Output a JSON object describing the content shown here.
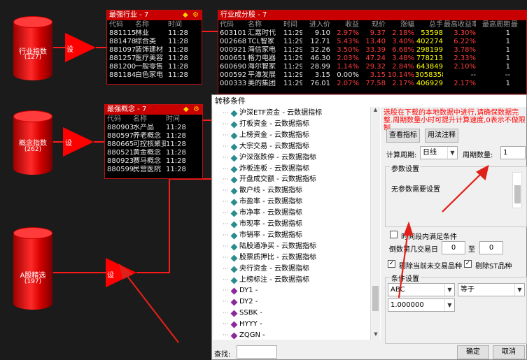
{
  "left_nodes": [
    {
      "label": "行业指数",
      "count": "(127)",
      "btn": "设"
    },
    {
      "label": "概念指数",
      "count": "(262)",
      "btn": "设"
    },
    {
      "label": "A股精选",
      "count": "(197)",
      "btn": "设"
    }
  ],
  "industry_panel": {
    "title": "最强行业 - 7",
    "headers": [
      "代码",
      "名称",
      "时间"
    ],
    "rows": [
      [
        "881115",
        "林业",
        "11:28"
      ],
      [
        "881478",
        "综合类",
        "11:28"
      ],
      [
        "881097",
        "装饰建材",
        "11:28"
      ],
      [
        "881257",
        "医疗美容",
        "11:28"
      ],
      [
        "881200",
        "一般零售",
        "11:28"
      ],
      [
        "881184",
        "白色家电",
        "11:28"
      ]
    ]
  },
  "concept_panel": {
    "title": "最强概念 - 7",
    "headers": [
      "代码",
      "名称",
      "时间"
    ],
    "rows": [
      [
        "880903",
        "水产品",
        "11:28"
      ],
      [
        "880597",
        "养老概念",
        "11:28"
      ],
      [
        "880665",
        "可控核聚变",
        "11:28"
      ],
      [
        "880521",
        "黄金概念",
        "11:28"
      ],
      [
        "880923",
        "赛马概念",
        "11:28"
      ],
      [
        "880599",
        "民营医院",
        "11:28"
      ]
    ]
  },
  "component_panel": {
    "title": "行业成分股 - 7",
    "headers": [
      "代码",
      "名称",
      "时间",
      "进入价",
      "收益",
      "现价",
      "涨幅",
      "总手",
      "最高收益率",
      "最高周期",
      "最"
    ],
    "rows": [
      [
        "603101",
        "汇嘉时代",
        "11:29",
        "9.10",
        "2.97%",
        "9.37",
        "2.18%",
        "53598",
        "3.30%",
        "1",
        ""
      ],
      [
        "002668",
        "TCL智家",
        "11:29",
        "12.71",
        "5.43%",
        "13.40",
        "3.40%",
        "402274",
        "6.22%",
        "1",
        ""
      ],
      [
        "000921",
        "海信家电",
        "11:29",
        "32.26",
        "3.50%",
        "33.39",
        "6.68%",
        "298199",
        "3.78%",
        "1",
        ""
      ],
      [
        "000651",
        "格力电器",
        "11:29",
        "46.30",
        "2.03%",
        "47.24",
        "3.48%",
        "778213",
        "2.33%",
        "1",
        ""
      ],
      [
        "600690",
        "海尔智家",
        "11:29",
        "28.99",
        "1.14%",
        "29.32",
        "2.84%",
        "643849",
        "2.10%",
        "1",
        ""
      ],
      [
        "000592",
        "平潭发展",
        "11:29",
        "3.15",
        "0.00%",
        "3.15",
        "10.14%",
        "3058358",
        "--",
        "--",
        ""
      ],
      [
        "000333",
        "美的集团",
        "11:29",
        "76.01",
        "2.07%",
        "77.58",
        "2.17%",
        "406929",
        "2.17%",
        "1",
        ""
      ]
    ]
  },
  "dialog": {
    "title": "转移条件",
    "list_items": [
      {
        "text": "沪深ETF资金 - 云数据指标",
        "kind": "teal"
      },
      {
        "text": "打板资金 - 云数据指标",
        "kind": "teal"
      },
      {
        "text": "上榜资金 - 云数据指标",
        "kind": "teal"
      },
      {
        "text": "大宗交易 - 云数据指标",
        "kind": "teal"
      },
      {
        "text": "沪深涨跌停 - 云数据指标",
        "kind": "teal"
      },
      {
        "text": "炸板连板 - 云数据指标",
        "kind": "teal"
      },
      {
        "text": "开盘成交额 - 云数据指标",
        "kind": "teal"
      },
      {
        "text": "散户线 - 云数据指标",
        "kind": "teal"
      },
      {
        "text": "市盈率 - 云数据指标",
        "kind": "teal"
      },
      {
        "text": "市净率 - 云数据指标",
        "kind": "teal"
      },
      {
        "text": "市现率 - 云数据指标",
        "kind": "teal"
      },
      {
        "text": "市销率 - 云数据指标",
        "kind": "teal"
      },
      {
        "text": "陆股通净买 - 云数据指标",
        "kind": "teal"
      },
      {
        "text": "股票质押比 - 云数据指标",
        "kind": "teal"
      },
      {
        "text": "央行资金 - 云数据指标",
        "kind": "teal"
      },
      {
        "text": "上榜标注 - 云数据指标",
        "kind": "teal"
      },
      {
        "text": "DY1 -",
        "kind": "purple"
      },
      {
        "text": "DY2 -",
        "kind": "purple"
      },
      {
        "text": "SSBK -",
        "kind": "purple"
      },
      {
        "text": "HYYY -",
        "kind": "purple"
      },
      {
        "text": "ZQGN -",
        "kind": "purple"
      }
    ],
    "warning": "选股在下载的本地数据中进行,请确保数据完整.周期数量小时可提升计算速度,0表示不做限制",
    "view_indicator_btn": "查看指标",
    "usage_note_btn": "用法注释",
    "calc_period_label": "计算周期:",
    "calc_period_value": "日线",
    "period_count_label": "周期数量:",
    "period_count_value": "1",
    "param_group_label": "参数设置",
    "param_text": "无参数需要设置",
    "satisfy_in_period_label": "时间段内满足条件",
    "recent_days_label": "倒数第几交易日",
    "from_value": "0",
    "to_label": "至",
    "to_value": "0",
    "exclude_untraded_label": "剔除当前未交易品种",
    "exclude_st_label": "剔除ST品种",
    "condition_group_label": "条件设置",
    "field_value": "ABC",
    "op_value": "等于",
    "threshold_value": "1.000000",
    "search_label": "查找:",
    "ok_btn": "确定",
    "cancel_btn": "取消"
  },
  "colors": {
    "accent_red": "#ff0000",
    "panel_header": "#c80000",
    "pos": "#ff3c3c",
    "neg": "#00ff00",
    "yellow": "#ffff00",
    "warn_text": "#ff0000"
  }
}
